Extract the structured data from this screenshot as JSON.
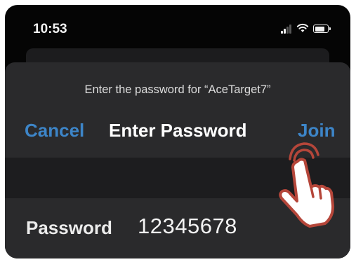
{
  "status_bar": {
    "time": "10:53",
    "icons": [
      "cellular-signal-icon",
      "wifi-icon",
      "battery-icon"
    ]
  },
  "dialog": {
    "prompt": "Enter the password for “AceTarget7”",
    "cancel_label": "Cancel",
    "title": "Enter Password",
    "join_label": "Join"
  },
  "password_field": {
    "label": "Password",
    "value": "12345678"
  },
  "colors": {
    "accent": "#3d85c8",
    "sheet_background": "#2a2a2c",
    "hand_fill": "#ffffff",
    "hand_outline": "#b5463a"
  },
  "annotation": {
    "icon": "tap-hand-icon"
  }
}
